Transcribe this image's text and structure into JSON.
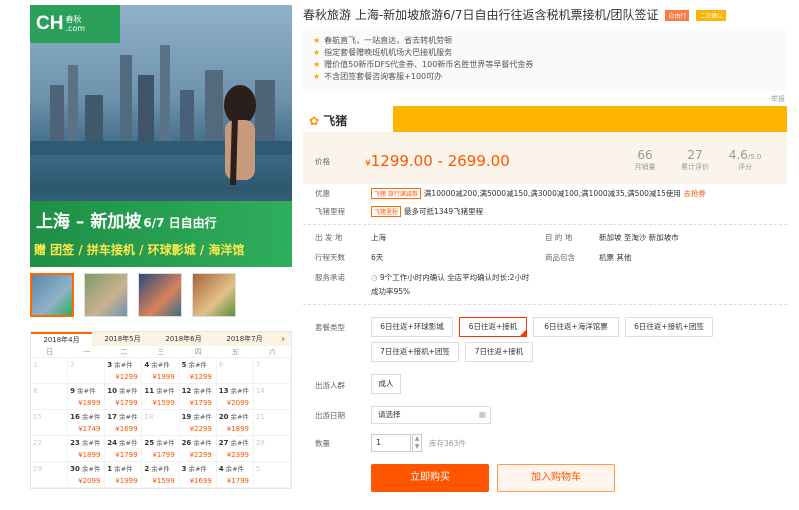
{
  "gallery": {
    "logo_text": "CH",
    "logo_cn_1": "春秋",
    "logo_cn_2": ".com",
    "route": "上海 – 新加坡",
    "route_sub": "6/7 日自由行",
    "features": "赠 团签 / 拼车接机 / 环球影城 / 海洋馆"
  },
  "calendar": {
    "months": [
      "2018年4月",
      "2018年5月",
      "2018年6月",
      "2018年7月"
    ],
    "next": "›",
    "weekdays": [
      "日",
      "一",
      "二",
      "三",
      "四",
      "五",
      "六"
    ],
    "remain_label": "余#",
    "cells": [
      {
        "d": "1",
        "off": true
      },
      {
        "d": "2",
        "off": true
      },
      {
        "d": "3",
        "s": "余#件",
        "p": "¥1299"
      },
      {
        "d": "4",
        "s": "余#件",
        "p": "¥1999"
      },
      {
        "d": "5",
        "s": "余#件",
        "p": "¥1299"
      },
      {
        "d": "6",
        "off": true
      },
      {
        "d": "7",
        "off": true
      },
      {
        "d": "8",
        "off": true
      },
      {
        "d": "9",
        "s": "余#件",
        "p": "¥1899"
      },
      {
        "d": "10",
        "s": "余#件",
        "p": "¥1799"
      },
      {
        "d": "11",
        "s": "余#件",
        "p": "¥1599"
      },
      {
        "d": "12",
        "s": "余#件",
        "p": "¥1799"
      },
      {
        "d": "13",
        "s": "余#件",
        "p": "¥2099"
      },
      {
        "d": "14",
        "off": true
      },
      {
        "d": "15",
        "off": true
      },
      {
        "d": "16",
        "s": "余#件",
        "p": "¥1749"
      },
      {
        "d": "17",
        "s": "余#件",
        "p": "¥1699"
      },
      {
        "d": "18",
        "off": true
      },
      {
        "d": "19",
        "s": "余#件",
        "p": "¥2299"
      },
      {
        "d": "20",
        "s": "余#件",
        "p": "¥1899"
      },
      {
        "d": "21",
        "off": true
      },
      {
        "d": "22",
        "off": true
      },
      {
        "d": "23",
        "s": "余#件",
        "p": "¥1899"
      },
      {
        "d": "24",
        "s": "余#件",
        "p": "¥1799"
      },
      {
        "d": "25",
        "s": "余#件",
        "p": "¥1799"
      },
      {
        "d": "26",
        "s": "余#件",
        "p": "¥2299"
      },
      {
        "d": "27",
        "s": "余#件",
        "p": "¥2399"
      },
      {
        "d": "28",
        "off": true
      },
      {
        "d": "29",
        "off": true
      },
      {
        "d": "30",
        "s": "余#件",
        "p": "¥2099"
      },
      {
        "d": "1",
        "s": "余#件",
        "p": "¥1999"
      },
      {
        "d": "2",
        "s": "余#件",
        "p": "¥1599"
      },
      {
        "d": "3",
        "s": "余#件",
        "p": "¥1699"
      },
      {
        "d": "4",
        "s": "余#件",
        "p": "¥1799"
      },
      {
        "d": "5",
        "off": true
      }
    ]
  },
  "product": {
    "title": "春秋旅游 上海-新加坡旅游6/7日自由行往返含税机票接机/团队签证",
    "badge1": "自由行",
    "badge2": "二次确认",
    "points": [
      "春航直飞，一站直达，省去转机劳顿",
      "指定套餐赠晚班机机场大巴接机服务",
      "赠价值50新币DFS代金券、100新币名胜世界等早餐代金券",
      "不含团签套餐咨询客服+100可办"
    ],
    "report": "举报",
    "brand": "飞猪"
  },
  "price": {
    "label": "价格",
    "range": "1299.00 - 2699.00",
    "currency": "¥",
    "stats": [
      {
        "v": "66",
        "k": "月销量"
      },
      {
        "v": "27",
        "k": "累计评价"
      },
      {
        "v": "4.6",
        "unit": "/5.0",
        "k": "评分"
      }
    ]
  },
  "promo": {
    "label": "优惠",
    "tag": "飞猪 旅行满减券",
    "text": "满10000减200,满5000减150,满3000减100,满1000减35,满500减15使用",
    "link": "去抢券",
    "miles_label": "飞猪里程",
    "miles_tag": "飞猪里程",
    "miles_text": "最多可抵1349飞猪里程"
  },
  "details": {
    "from_label": "出 发 地",
    "from": "上海",
    "dest_label": "目 的 地",
    "dest": "新加坡 圣淘沙 新加坡市",
    "days_label": "行程天数",
    "days": "6天",
    "incl_label": "商品包含",
    "incl": "机票 其他",
    "svc_label": "服务承诺",
    "svc": "9个工作小时内确认 全店平均确认时长:2小时",
    "svc2": "成功率95%"
  },
  "options": {
    "package_label": "套餐类型",
    "packages": [
      "6日往返+环球影城",
      "6日往返+接机",
      "6日往返+海洋馆票",
      "6日往返+接机+团签",
      "7日往返+接机+团签",
      "7日往返+接机"
    ],
    "crowd_label": "出游人群",
    "crowd": "成人",
    "date_label": "出游日期",
    "date_placeholder": "请选择",
    "qty_label": "数量",
    "qty": "1",
    "stock": "库存363件",
    "buy": "立即购买",
    "cart": "加入购物车"
  }
}
